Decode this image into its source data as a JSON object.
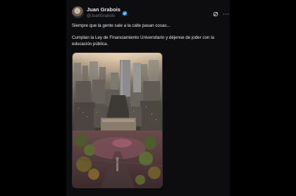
{
  "post": {
    "author_name": "Juan Grabois",
    "author_handle": "@JuanGrabois",
    "text_line_1": "Siempre que la gente sale a la calle pasan cosas...",
    "text_line_2": "Cumplan la Ley de Financiamiento Universitario y déjense de joder con la educación pública.",
    "verified": true,
    "icons": {
      "avatar": "avatar",
      "verified": "verified-badge-icon",
      "grok": "grok-icon",
      "more": "more-options-icon"
    },
    "image_description_present": true
  },
  "colors": {
    "background": "#000000",
    "card": "#0d0d0f",
    "text_primary": "#e7e9ea",
    "text_secondary": "#71767b",
    "verified_blue": "#1d9bf0"
  }
}
